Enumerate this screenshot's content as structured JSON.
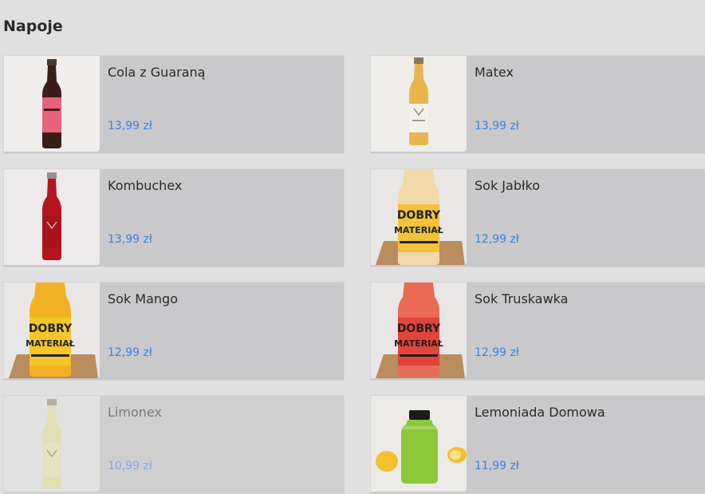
{
  "section": {
    "title": "Napoje"
  },
  "products": [
    {
      "name": "Cola z Guaraną",
      "price": "13,99 zł",
      "image": "bottle-cola-icon",
      "liquid": "#3b1e18",
      "label": "#e8637a",
      "available": true
    },
    {
      "name": "Matex",
      "price": "13,99 zł",
      "image": "bottle-matex-icon",
      "liquid": "#e6b64a",
      "label": "#f4f1ea",
      "available": true
    },
    {
      "name": "Kombuchex",
      "price": "13,99 zł",
      "image": "bottle-kombuchex-icon",
      "liquid": "#b5151f",
      "label": "#a8141c",
      "available": true
    },
    {
      "name": "Sok Jabłko",
      "price": "12,99 zł",
      "image": "bottle-apple-juice-icon",
      "liquid": "#f1d8a8",
      "label": "#f2c23a",
      "available": true
    },
    {
      "name": "Sok Mango",
      "price": "12,99 zł",
      "image": "bottle-mango-juice-icon",
      "liquid": "#f2b124",
      "label": "#f5c629",
      "available": true
    },
    {
      "name": "Sok Truskawka",
      "price": "12,99 zł",
      "image": "bottle-strawberry-juice-icon",
      "liquid": "#e96b55",
      "label": "#e0453b",
      "available": true
    },
    {
      "name": "Limonex",
      "price": "10,99 zł",
      "image": "bottle-limonex-icon",
      "liquid": "#efe9a0",
      "label": "#efe9a0",
      "available": false
    },
    {
      "name": "Lemoniada Domowa",
      "price": "11,99 zł",
      "image": "bottle-lemonade-icon",
      "liquid": "#8cc83a",
      "label": "#8cc83a",
      "available": true
    }
  ],
  "brand_label": {
    "line1": "DOBRY",
    "line2": "MATERIAŁ"
  }
}
